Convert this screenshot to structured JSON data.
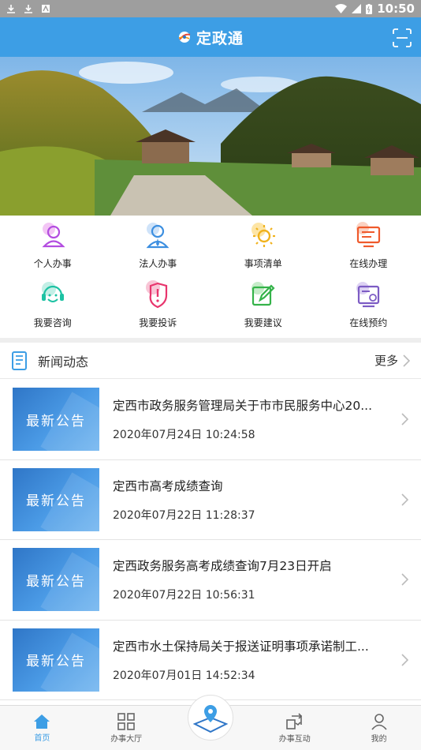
{
  "status_bar": {
    "time": "10:50"
  },
  "header": {
    "title": "定政通"
  },
  "grid": [
    {
      "label": "个人办事",
      "icon": "person-icon",
      "color": "#b34de0"
    },
    {
      "label": "法人办事",
      "icon": "legal-person-icon",
      "color": "#3d8fe0"
    },
    {
      "label": "事项清单",
      "icon": "sun-list-icon",
      "color": "#f0b21d"
    },
    {
      "label": "在线办理",
      "icon": "monitor-icon",
      "color": "#ef5a2c"
    },
    {
      "label": "我要咨询",
      "icon": "consult-icon",
      "color": "#1dc2a3"
    },
    {
      "label": "我要投诉",
      "icon": "complaint-icon",
      "color": "#e8356d"
    },
    {
      "label": "我要建议",
      "icon": "suggest-icon",
      "color": "#35b34a"
    },
    {
      "label": "在线预约",
      "icon": "appointment-icon",
      "color": "#7d5cc4"
    }
  ],
  "news": {
    "section_title": "新闻动态",
    "more_label": "更多",
    "thumb_label": "最新公告",
    "items": [
      {
        "title": "定西市政务服务管理局关于市市民服务中心20...",
        "date": "2020年07月24日 10:24:58"
      },
      {
        "title": "定西市高考成绩查询",
        "date": "2020年07月22日 11:28:37"
      },
      {
        "title": "定西政务服务高考成绩查询7月23日开启",
        "date": "2020年07月22日 10:56:31"
      },
      {
        "title": "定西市水土保持局关于报送证明事项承诺制工...",
        "date": "2020年07月01日 14:52:34"
      }
    ]
  },
  "bottom_nav": [
    {
      "label": "首页",
      "icon": "home-icon"
    },
    {
      "label": "办事大厅",
      "icon": "hall-icon"
    },
    {
      "label": "办事互动",
      "icon": "interact-icon"
    },
    {
      "label": "我的",
      "icon": "profile-icon"
    }
  ]
}
